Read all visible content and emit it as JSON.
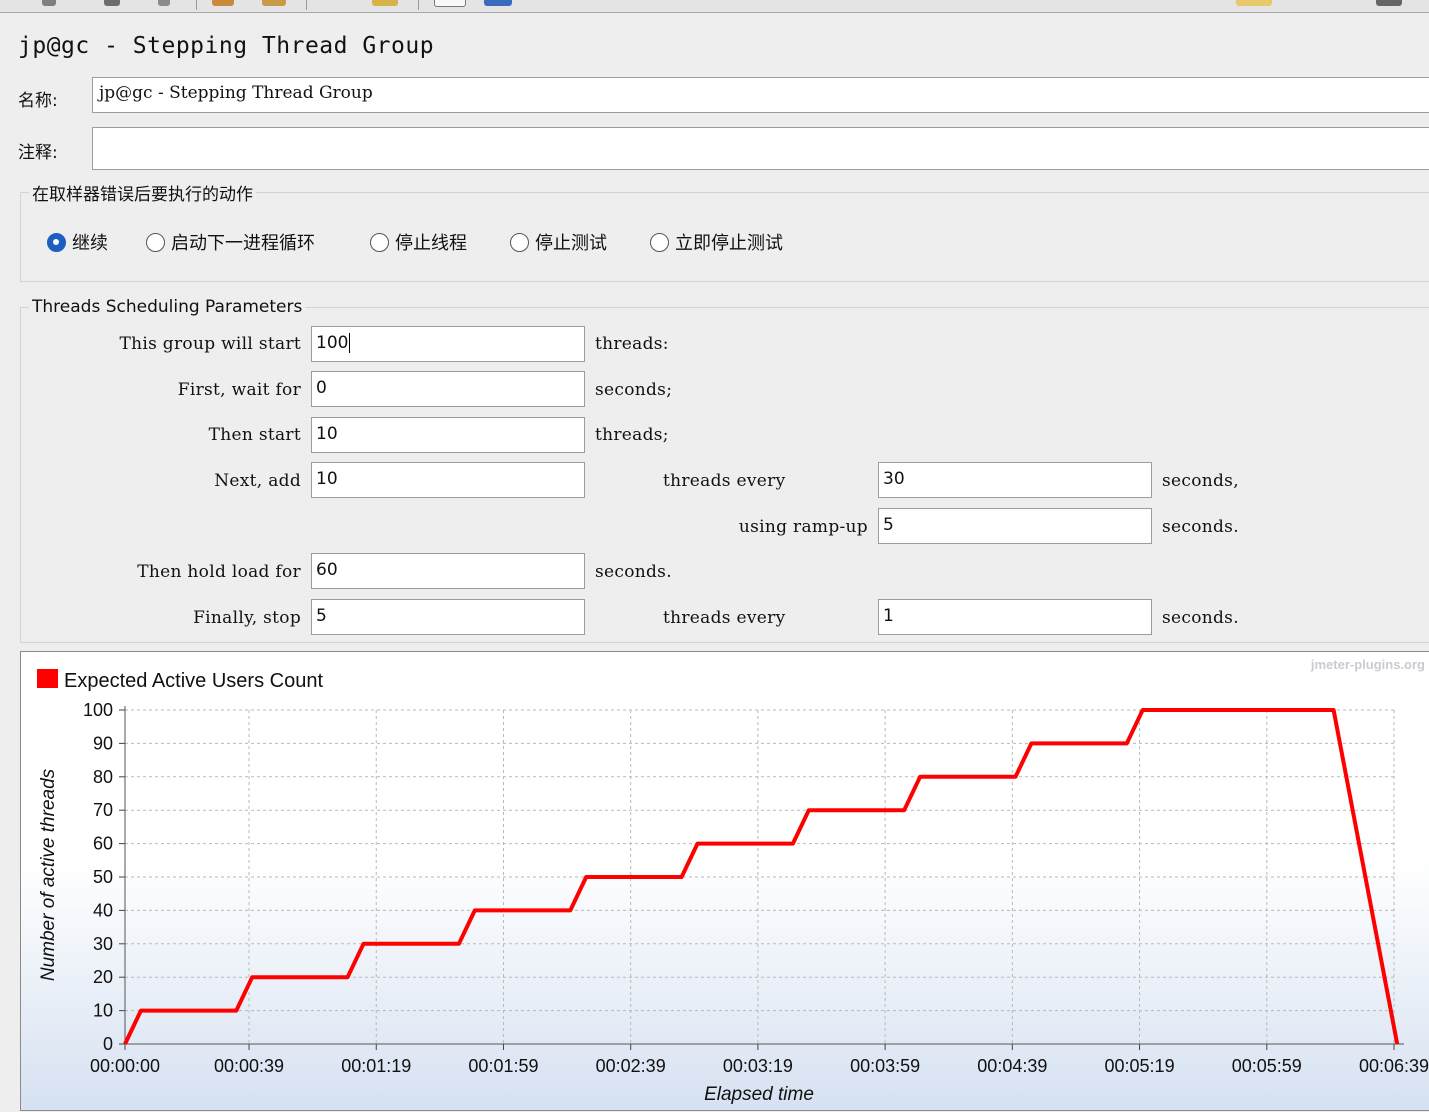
{
  "panel": {
    "title": "jp@gc - Stepping Thread Group",
    "name_label": "名称:",
    "name_value": "jp@gc - Stepping Thread Group",
    "comment_label": "注释:",
    "comment_value": ""
  },
  "error_action": {
    "legend": "在取样器错误后要执行的动作",
    "selected": "继续",
    "options": [
      "继续",
      "启动下一进程循环",
      "停止线程",
      "停止测试",
      "立即停止测试"
    ]
  },
  "scheduling": {
    "legend": "Threads Scheduling Parameters",
    "start_label": "This group will start",
    "start_threads": "100",
    "start_unit": "threads:",
    "wait_label": "First, wait for",
    "wait_seconds": "0",
    "wait_unit": "seconds;",
    "then_start_label": "Then start",
    "then_start_threads": "10",
    "then_start_unit": "threads;",
    "next_add_label": "Next, add",
    "next_add_threads": "10",
    "threads_every_label": "threads every",
    "next_add_every": "30",
    "next_add_unit": "seconds,",
    "rampup_label": "using ramp-up",
    "rampup_seconds": "5",
    "rampup_unit": "seconds.",
    "hold_label": "Then hold load for",
    "hold_seconds": "60",
    "hold_unit": "seconds.",
    "stop_label": "Finally, stop",
    "stop_threads": "5",
    "stop_every_label": "threads every",
    "stop_every": "1",
    "stop_unit": "seconds."
  },
  "colors": {
    "series": "#ff0000",
    "radio_selected": "#1b5fbf",
    "watermark": "#c8ccd2"
  },
  "chart_data": {
    "type": "line",
    "watermark": "jmeter-plugins.org",
    "xlabel": "Elapsed time",
    "ylabel": "Number of active threads",
    "xlim": [
      0,
      399
    ],
    "ylim": [
      0,
      100
    ],
    "grid": true,
    "legend_position": "top-left",
    "x_ticks": [
      0,
      39,
      79,
      119,
      159,
      199,
      239,
      279,
      319,
      359,
      399
    ],
    "x_tick_labels": [
      "00:00:00",
      "00:00:39",
      "00:01:19",
      "00:01:59",
      "00:02:39",
      "00:03:19",
      "00:03:59",
      "00:04:39",
      "00:05:19",
      "00:05:59",
      "00:06:39"
    ],
    "y_ticks": [
      0,
      10,
      20,
      30,
      40,
      50,
      60,
      70,
      80,
      90,
      100
    ],
    "series": [
      {
        "name": "Expected Active Users Count",
        "x": [
          0,
          5,
          35,
          40,
          70,
          75,
          105,
          110,
          140,
          145,
          175,
          180,
          210,
          215,
          245,
          250,
          280,
          285,
          315,
          320,
          380,
          400
        ],
        "y": [
          0,
          10,
          10,
          20,
          20,
          30,
          30,
          40,
          40,
          50,
          50,
          60,
          60,
          70,
          70,
          80,
          80,
          90,
          90,
          100,
          100,
          0
        ]
      }
    ]
  }
}
